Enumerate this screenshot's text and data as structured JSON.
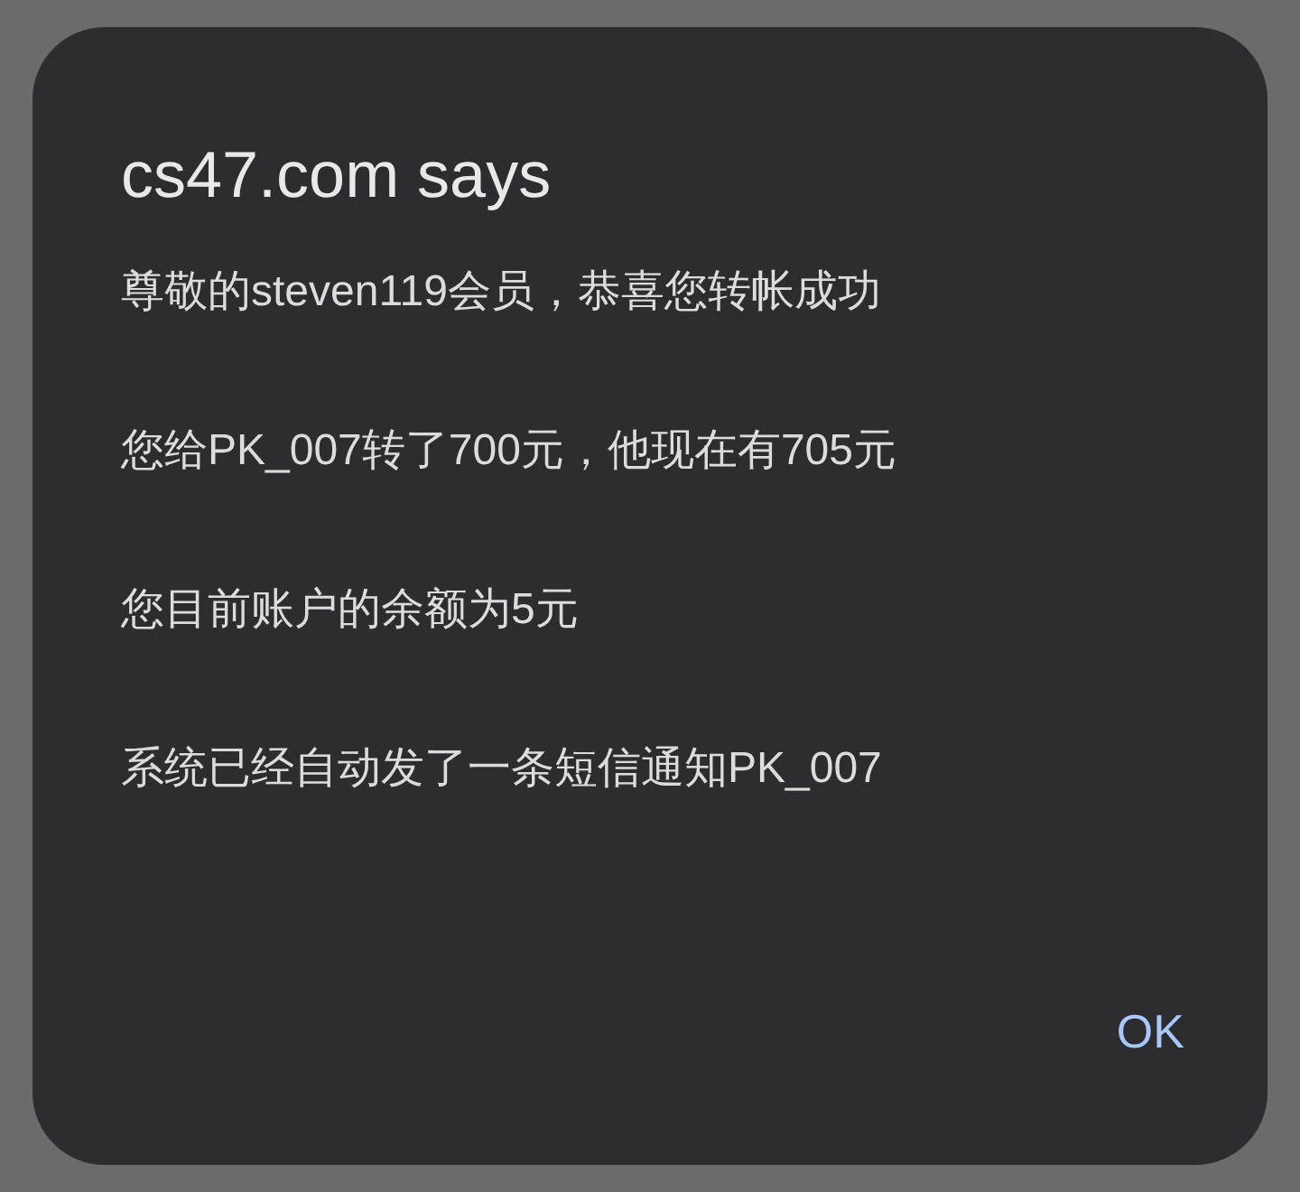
{
  "dialog": {
    "title": "cs47.com says",
    "message_lines": [
      "尊敬的steven119会员，恭喜您转帐成功",
      "您给PK_007转了700元，他现在有705元",
      "您目前账户的余额为5元",
      "系统已经自动发了一条短信通知PK_007"
    ],
    "buttons": [
      "OK"
    ]
  }
}
